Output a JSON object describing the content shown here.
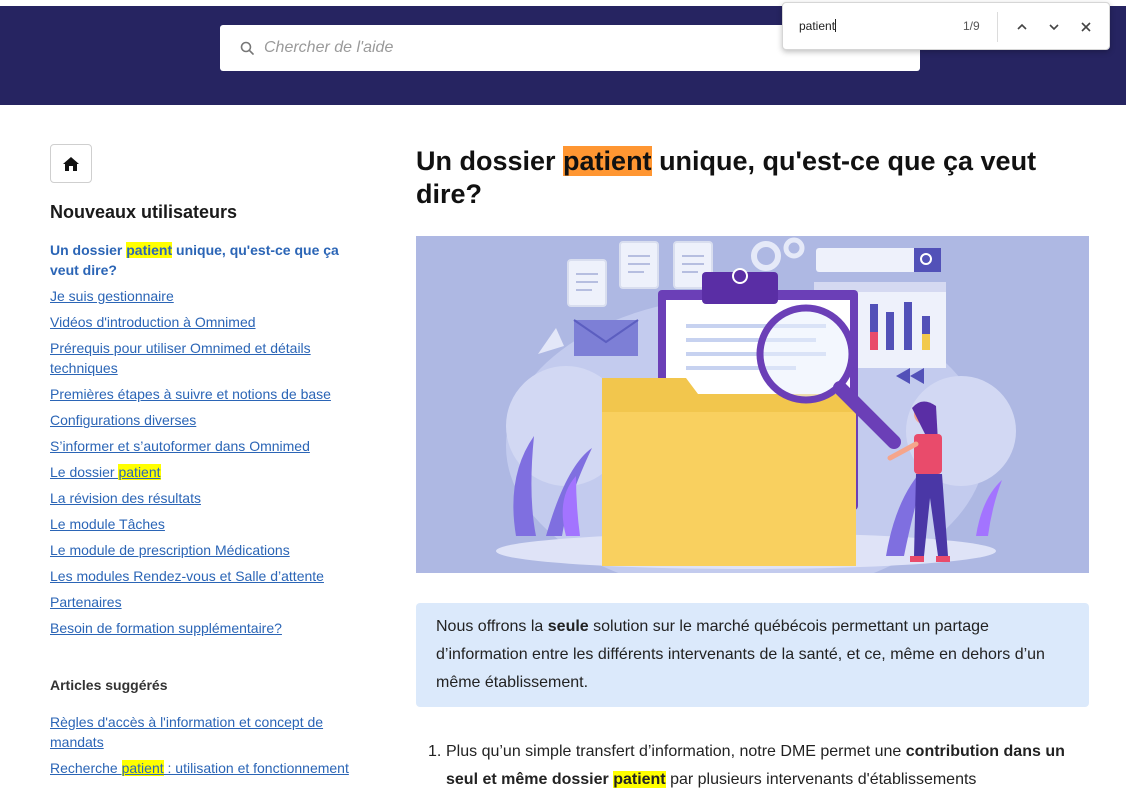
{
  "search": {
    "placeholder": "Chercher de l'aide",
    "icon": "search-icon"
  },
  "findbar": {
    "query": "patient",
    "count": "1/9"
  },
  "sidebar": {
    "title": "Nouveaux utilisateurs",
    "items": [
      {
        "pre": "Un dossier ",
        "match": "patient",
        "post": " unique, qu'est-ce que ça veut dire?"
      },
      {
        "pre": "Je suis gestionnaire",
        "match": "",
        "post": ""
      },
      {
        "pre": "Vidéos d'introduction à Omnimed",
        "match": "",
        "post": ""
      },
      {
        "pre": "Prérequis pour utiliser Omnimed et détails techniques",
        "match": "",
        "post": ""
      },
      {
        "pre": "Premières étapes à suivre et notions de base",
        "match": "",
        "post": ""
      },
      {
        "pre": "Configurations diverses",
        "match": "",
        "post": ""
      },
      {
        "pre": "S’informer et s’autoformer dans Omnimed",
        "match": "",
        "post": ""
      },
      {
        "pre": "Le dossier ",
        "match": "patient",
        "post": ""
      },
      {
        "pre": "La révision des résultats",
        "match": "",
        "post": ""
      },
      {
        "pre": "Le module Tâches",
        "match": "",
        "post": ""
      },
      {
        "pre": "Le module de prescription Médications",
        "match": "",
        "post": ""
      },
      {
        "pre": "Les modules Rendez-vous et Salle d’attente",
        "match": "",
        "post": ""
      },
      {
        "pre": "Partenaires",
        "match": "",
        "post": ""
      },
      {
        "pre": "Besoin de formation supplémentaire?",
        "match": "",
        "post": ""
      }
    ],
    "suggested_title": "Articles suggérés",
    "suggested": [
      {
        "pre": "Règles d'accès à l'information et concept de mandats",
        "match": "",
        "post": ""
      },
      {
        "pre": "Recherche ",
        "match": "patient",
        "post": " : utilisation et fonctionnement"
      }
    ]
  },
  "article": {
    "title_pre": "Un dossier ",
    "title_match": "patient",
    "title_post": " unique, qu'est-ce que ça veut dire?",
    "callout_pre": "Nous offrons la ",
    "callout_bold": "seule",
    "callout_post": " solution sur le marché québécois permettant un partage d’information entre les différents intervenants de la santé, et ce, même en dehors d’un même établissement.",
    "step_num": "1.",
    "step_pre": "Plus qu’un simple transfert d’information, notre DME permet une ",
    "step_bold": "contribution dans un seul et même dossier ",
    "step_match": "patient",
    "step_post": " par plusieurs intervenants d'établissements"
  },
  "colors": {
    "header": "#262461",
    "link": "#2b65b6",
    "highlight": "#ffff00",
    "current_match": "#ff9632",
    "callout_bg": "#dbe9fb"
  }
}
